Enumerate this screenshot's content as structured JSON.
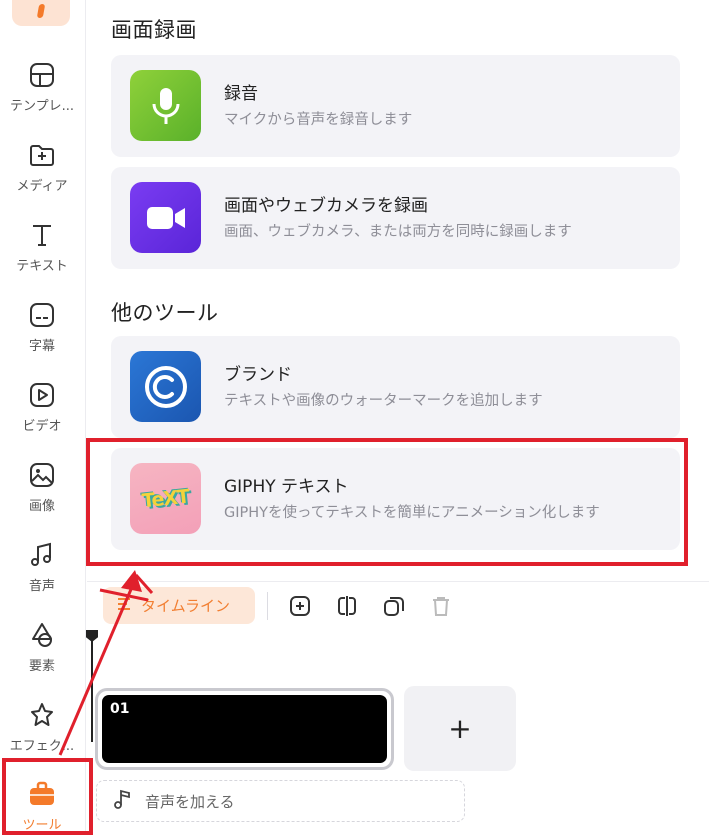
{
  "sidebar": {
    "items": [
      {
        "label": "テンプレ..."
      },
      {
        "label": "メディア"
      },
      {
        "label": "テキスト"
      },
      {
        "label": "字幕"
      },
      {
        "label": "ビデオ"
      },
      {
        "label": "画像"
      },
      {
        "label": "音声"
      },
      {
        "label": "要素"
      },
      {
        "label": "エフェク..."
      },
      {
        "label": "ツール"
      }
    ]
  },
  "sections": {
    "recording_title": "画面録画",
    "other_tools_title": "他のツール"
  },
  "cards": [
    {
      "title": "録音",
      "desc": "マイクから音声を録音します"
    },
    {
      "title": "画面やウェブカメラを録画",
      "desc": "画面、ウェブカメラ、または両方を同時に録画します"
    },
    {
      "title": "ブランド",
      "desc": "テキストや画像のウォーターマークを追加します"
    },
    {
      "title": "GIPHY テキスト",
      "desc": "GIPHYを使ってテキストを簡単にアニメーション化します",
      "thumb_text": "TeXT"
    }
  ],
  "timeline": {
    "chip_label": "タイムライン",
    "clip_number": "01",
    "add_label": "+",
    "audio_label": "音声を加える"
  },
  "colors": {
    "accent": "#f27f32",
    "annotation_red": "#e0202c"
  }
}
